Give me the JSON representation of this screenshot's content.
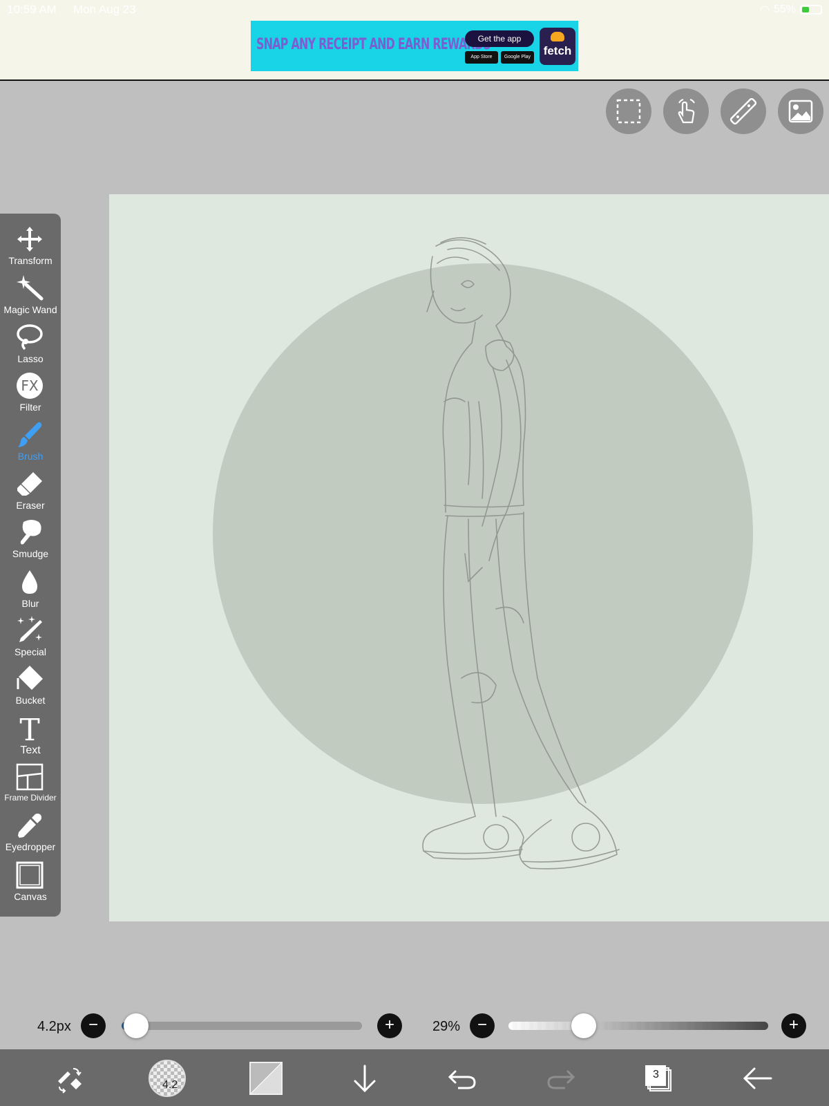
{
  "status_bar": {
    "time": "10:59 AM",
    "date": "Mon Aug 23",
    "battery": "55%"
  },
  "ad": {
    "headline": "SNAP ANY RECEIPT AND EARN REWARDS",
    "cta": "Get the app",
    "store_apple": "App Store",
    "store_google": "Google Play",
    "brand": "fetch"
  },
  "top_buttons": [
    {
      "name": "selection",
      "icon": "dashed-rect-icon"
    },
    {
      "name": "hand",
      "icon": "hand-tap-icon"
    },
    {
      "name": "ruler",
      "icon": "ruler-icon"
    },
    {
      "name": "material",
      "icon": "image-icon"
    }
  ],
  "tools": [
    {
      "label": "Transform",
      "icon": "transform-icon"
    },
    {
      "label": "Magic Wand",
      "icon": "magic-wand-icon"
    },
    {
      "label": "Lasso",
      "icon": "lasso-icon"
    },
    {
      "label": "Filter",
      "icon": "fx-icon"
    },
    {
      "label": "Brush",
      "icon": "brush-icon",
      "active": true
    },
    {
      "label": "Eraser",
      "icon": "eraser-icon"
    },
    {
      "label": "Smudge",
      "icon": "smudge-icon"
    },
    {
      "label": "Blur",
      "icon": "blur-icon"
    },
    {
      "label": "Special",
      "icon": "special-icon"
    },
    {
      "label": "Bucket",
      "icon": "bucket-icon"
    },
    {
      "label": "Text",
      "icon": "text-icon"
    },
    {
      "label": "Frame Divider",
      "icon": "frame-divider-icon"
    },
    {
      "label": "Eyedropper",
      "icon": "eyedropper-icon"
    },
    {
      "label": "Canvas",
      "icon": "canvas-icon"
    }
  ],
  "brush_size": {
    "value": "4.2px",
    "fraction": 0.06
  },
  "opacity": {
    "value": "29%",
    "fraction": 0.29
  },
  "bottom_bar": {
    "brush_preview_value": "4.2",
    "layers_count": "3",
    "icons": [
      "swap-tool-icon",
      "brush-preview-icon",
      "color-swatch-icon",
      "download-arrow-icon",
      "undo-icon",
      "redo-icon",
      "layers-icon",
      "back-arrow-icon"
    ]
  },
  "colors": {
    "canvas_bg": "#dfe8df",
    "circle": "#c1cbc0",
    "toolbar": "#6a6a6a",
    "active_tool": "#3f9ff5"
  }
}
